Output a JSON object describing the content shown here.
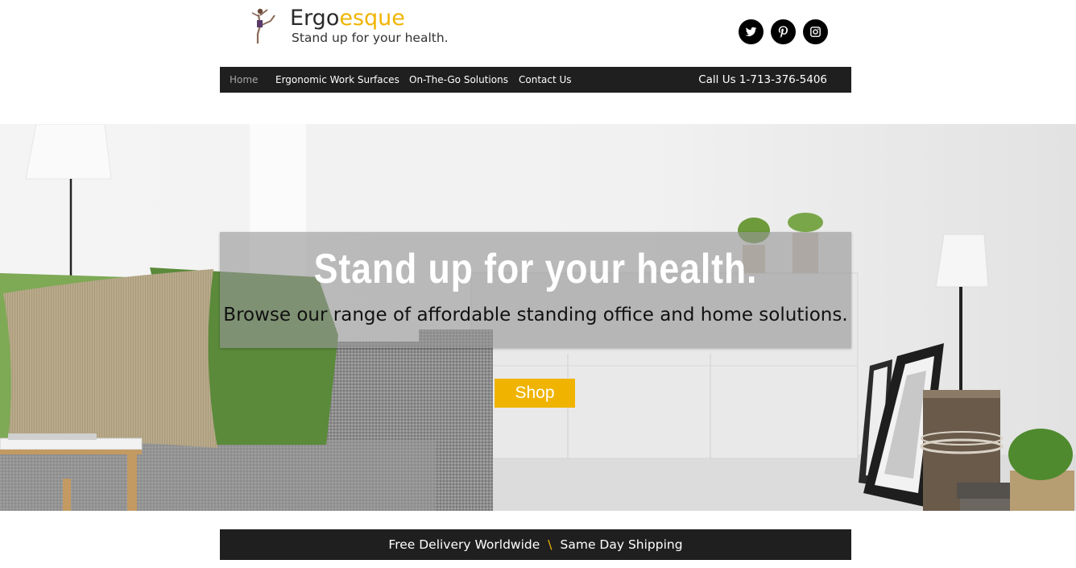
{
  "brand": {
    "name_part1": "Ergo",
    "name_part2": "esque",
    "tagline": "Stand up for your health.",
    "logo_icon": "yoga-figure-icon",
    "accent_color": "#f0b400"
  },
  "social": [
    {
      "name": "twitter",
      "icon": "twitter-icon"
    },
    {
      "name": "pinterest",
      "icon": "pinterest-icon"
    },
    {
      "name": "instagram",
      "icon": "instagram-icon"
    }
  ],
  "nav": {
    "items": [
      {
        "label": "Home",
        "active": true
      },
      {
        "label": "Ergonomic Work Surfaces",
        "active": false
      },
      {
        "label": "On-The-Go Solutions",
        "active": false
      },
      {
        "label": "Contact Us",
        "active": false
      }
    ],
    "phone": "Call Us 1-713-376-5406",
    "background": "#1f1f1f"
  },
  "hero": {
    "title": "Stand up for your health.",
    "subtitle": "Browse our range of affordable standing office and home solutions.",
    "button_label": "Shop",
    "button_color": "#f0b400"
  },
  "shipping_bar": {
    "left": "Free Delivery Worldwide",
    "separator": "\\",
    "right": "Same Day Shipping"
  }
}
